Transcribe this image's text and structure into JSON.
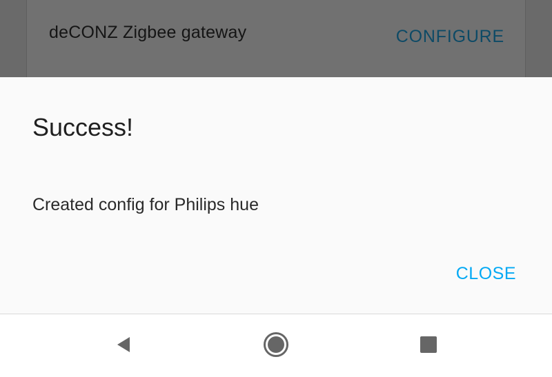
{
  "background_card": {
    "title": "deCONZ Zigbee gateway",
    "action_label": "CONFIGURE"
  },
  "dialog": {
    "title": "Success!",
    "message": "Created config for Philips hue",
    "close_label": "CLOSE"
  },
  "navbar": {
    "icons": [
      "back-icon",
      "home-icon",
      "recents-icon"
    ]
  },
  "colors": {
    "accent": "#03a9f4",
    "dimmed_accent": "#0d4a66",
    "dialog_background": "#fafafa",
    "scrim": "#6b6b6b",
    "navbar_icon": "#666666"
  }
}
